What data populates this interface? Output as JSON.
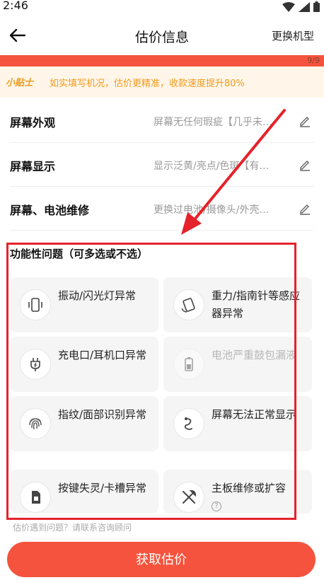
{
  "status_bar": {
    "time": "2:46"
  },
  "nav": {
    "title": "估价信息",
    "action_label": "更换机型"
  },
  "progress": {
    "text": "9/9",
    "fraction": 1.0
  },
  "tip": {
    "badge": "小贴士",
    "text": "如实填写机况，估价更精准，收款速度提升80%"
  },
  "fields": [
    {
      "label": "屏幕外观",
      "value": "屏幕无任何瑕疵【几乎未…"
    },
    {
      "label": "屏幕显示",
      "value": "显示泛黄/亮点/色斑【有…"
    },
    {
      "label": "屏幕、电池维修",
      "value": "更换过电池/摄像头/外壳…"
    }
  ],
  "section": {
    "title": "功能性问题（可多选或不选）"
  },
  "options": [
    {
      "label": "振动/闪光灯异常",
      "icon": "phone-vibrate-icon",
      "disabled": false
    },
    {
      "label": "重力/指南针等感应器异常",
      "icon": "phone-rotate-icon",
      "disabled": false
    },
    {
      "label": "充电口/耳机口异常",
      "icon": "plug-icon",
      "disabled": false
    },
    {
      "label": "电池严重鼓包漏液",
      "icon": "battery-icon",
      "disabled": true
    },
    {
      "label": "指纹/面部识别异常",
      "icon": "fingerprint-icon",
      "disabled": false
    },
    {
      "label": "屏幕无法正常显示",
      "icon": "squiggle-icon",
      "disabled": false
    },
    {
      "label": "按键失灵/卡槽异常",
      "icon": "sim-card-icon",
      "disabled": false
    },
    {
      "label": "主板维修或扩容",
      "icon": "tools-icon",
      "disabled": false,
      "help_mark": "?"
    }
  ],
  "footer": {
    "contact_text": "估价遇到问题？请联系咨询顾问",
    "primary_button": "获取估价"
  },
  "colors": {
    "accent": "#f5533d",
    "tip_text": "#f29a1f",
    "annotation": "#e5222a"
  }
}
